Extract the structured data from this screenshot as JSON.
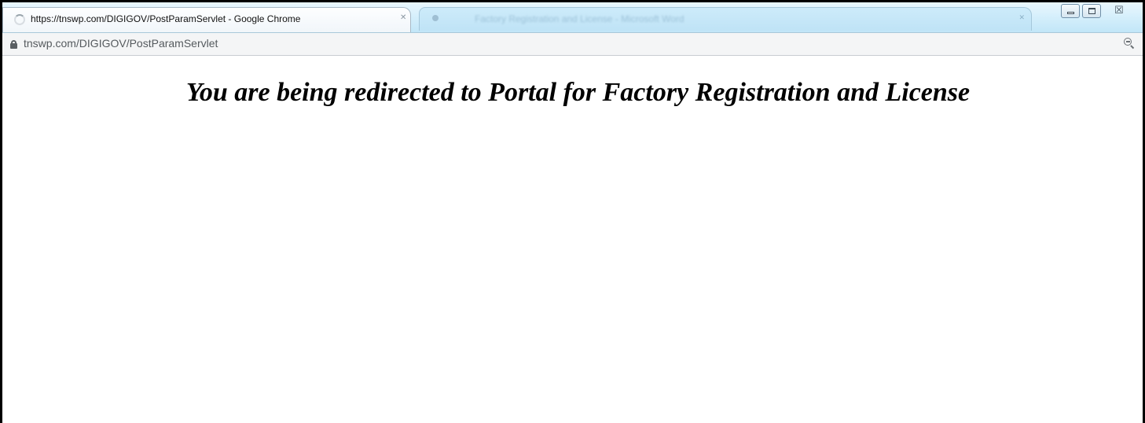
{
  "window": {
    "title": "https://tnswp.com/DIGIGOV/PostParamServlet - Google Chrome",
    "background_tab_title": "Factory Registration and License - Microsoft Word",
    "controls": {
      "minimize_icon": "minimize-icon",
      "restore_icon": "restore-icon",
      "close_glyph": "☒"
    }
  },
  "address_bar": {
    "url": "tnswp.com/DIGIGOV/PostParamServlet",
    "lock_icon": "lock-icon",
    "zoom_icon": "zoom-out-icon"
  },
  "page": {
    "heading": "You are being redirected to Portal for Factory Registration and License"
  },
  "colors": {
    "title_bar": "#d3eefb",
    "frame_border": "#000000",
    "page_background": "#ffffff",
    "heading_text": "#000000"
  }
}
